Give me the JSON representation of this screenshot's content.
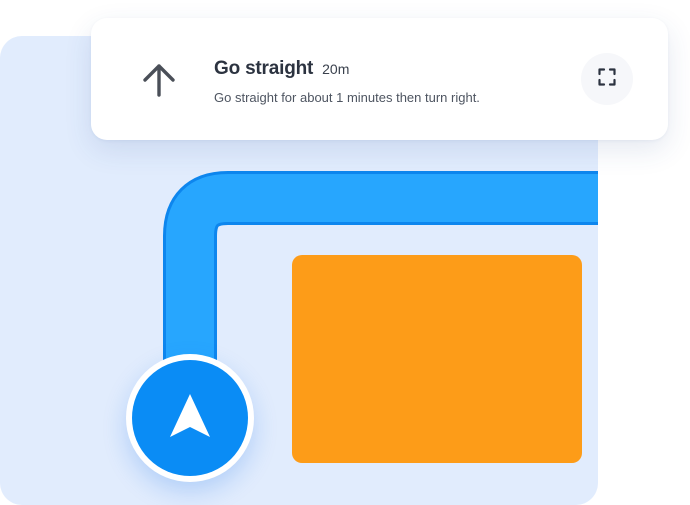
{
  "instruction": {
    "title": "Go straight",
    "distance": "20m",
    "description": "Go straight for about 1 minutes then turn right."
  },
  "icons": {
    "direction": "arrow-up-icon",
    "expand": "fullscreen-icon",
    "location": "navigation-arrow-icon"
  },
  "colors": {
    "map_background": "#e1ecfd",
    "route": "#27a6fe",
    "route_outline": "#0d86ee",
    "building": "#fd9c18",
    "location_marker": "#0a8cf5",
    "card_background": "#ffffff",
    "title_text": "#2c3340"
  }
}
